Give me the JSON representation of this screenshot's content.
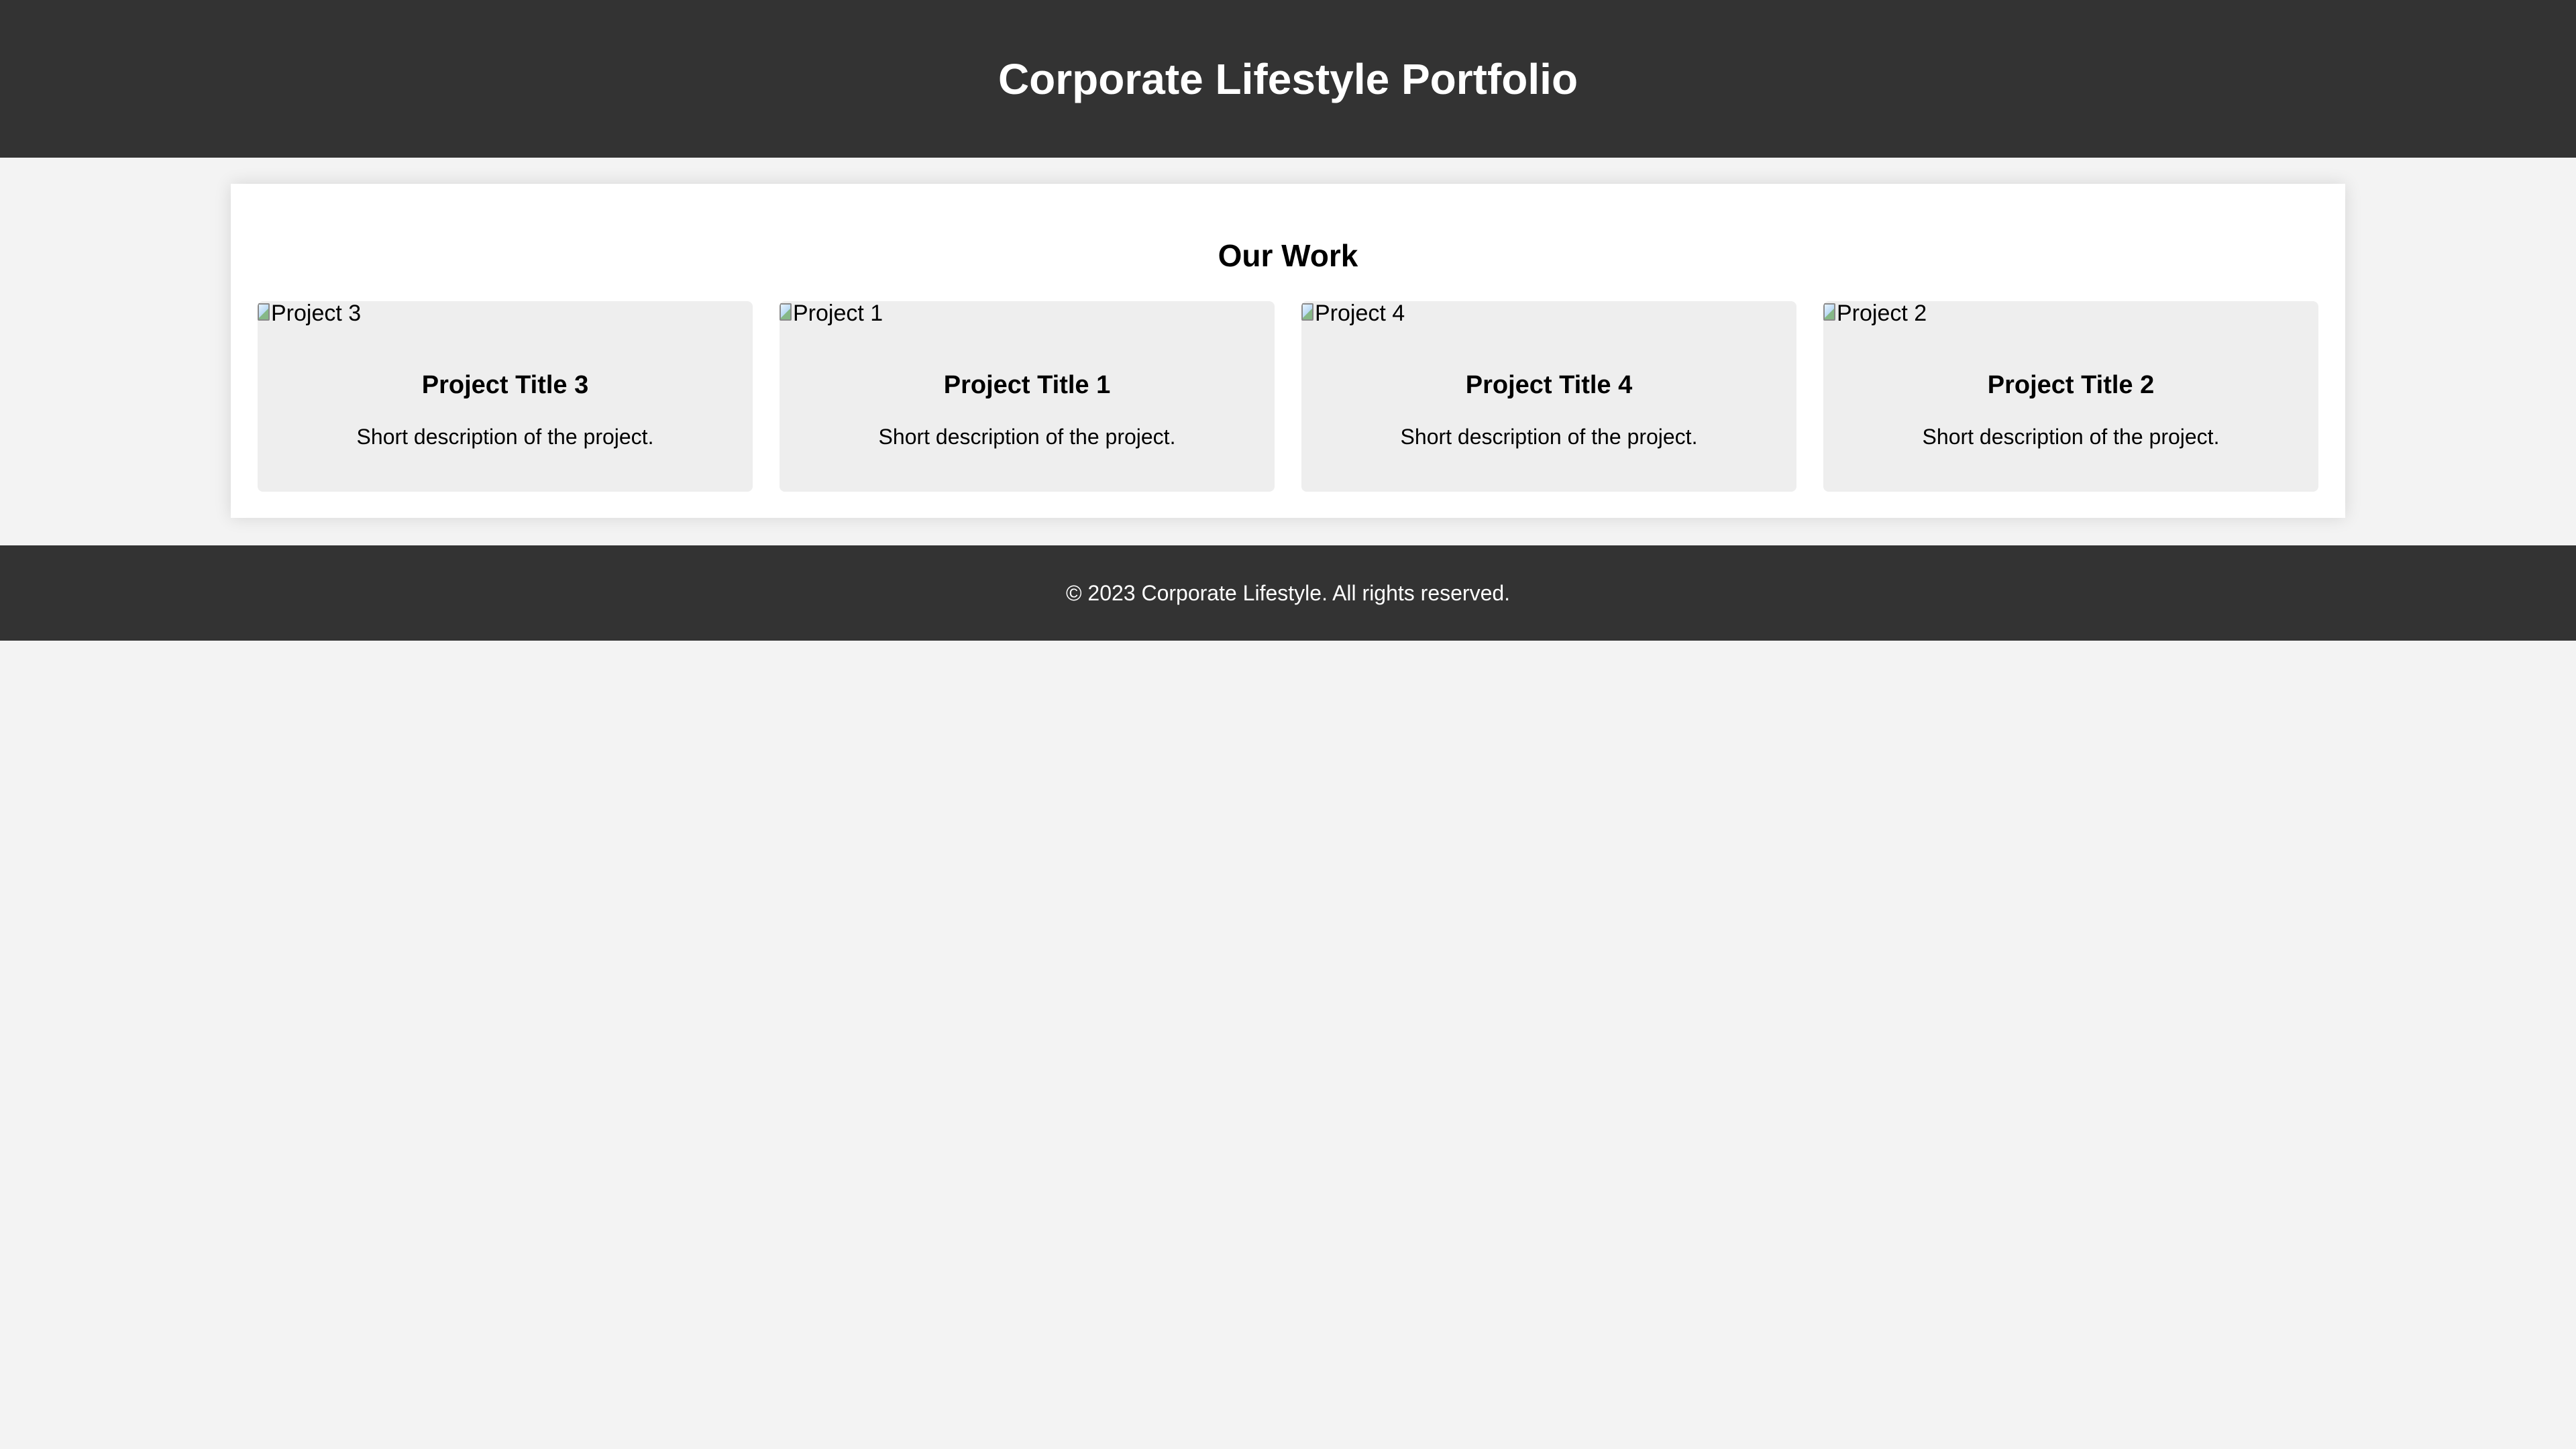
{
  "header": {
    "title": "Corporate Lifestyle Portfolio"
  },
  "portfolio": {
    "title": "Our Work",
    "projects": [
      {
        "image_alt": "Project 3",
        "title": "Project Title 3",
        "description": "Short description of the project."
      },
      {
        "image_alt": "Project 1",
        "title": "Project Title 1",
        "description": "Short description of the project."
      },
      {
        "image_alt": "Project 4",
        "title": "Project Title 4",
        "description": "Short description of the project."
      },
      {
        "image_alt": "Project 2",
        "title": "Project Title 2",
        "description": "Short description of the project."
      }
    ]
  },
  "footer": {
    "copyright": "© 2023 Corporate Lifestyle. All rights reserved."
  },
  "theme": {
    "header_background": "#333333",
    "page_background": "#f3f3f3",
    "panel_background": "#ffffff",
    "card_background": "#eeeeee",
    "header_text": "#ffffff"
  },
  "icons": {
    "broken_image": "broken-image-icon"
  }
}
